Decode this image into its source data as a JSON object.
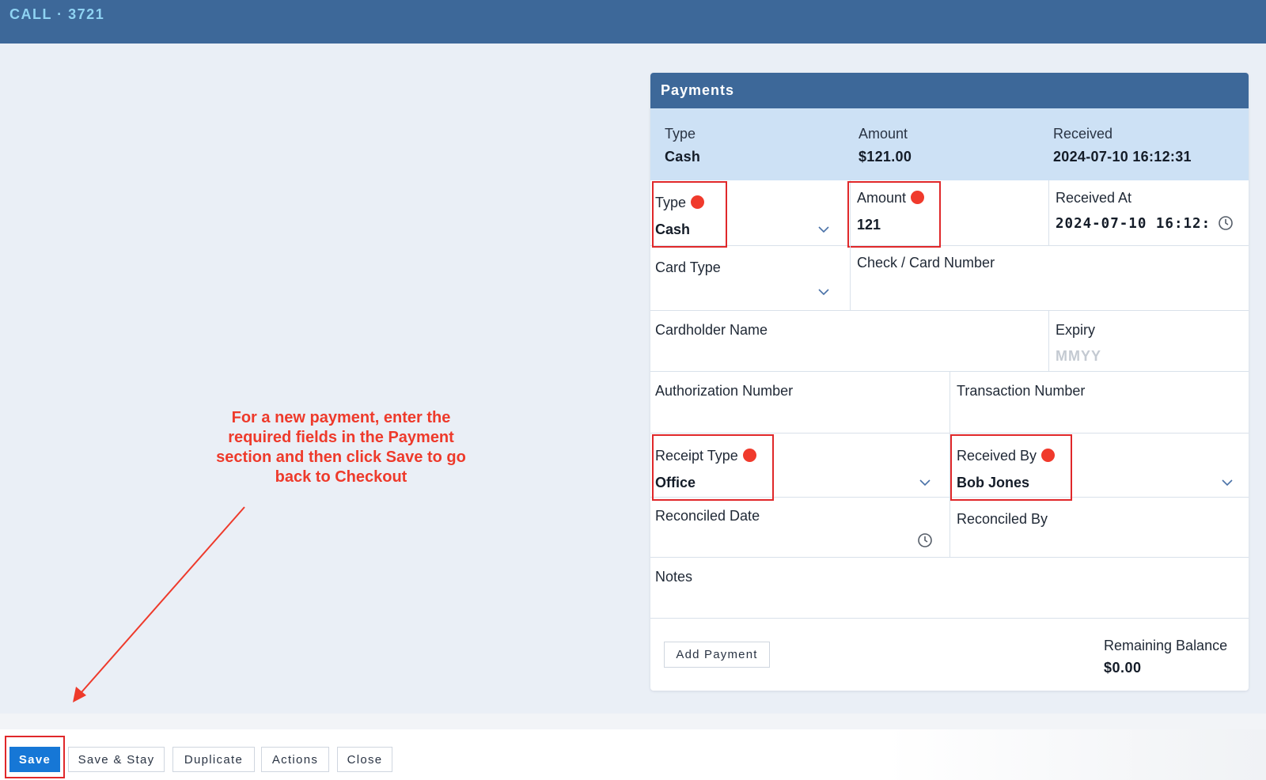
{
  "window": {
    "title": "CALL · 3721"
  },
  "payments": {
    "title": "Payments",
    "summary": {
      "type_label": "Type",
      "type_value": "Cash",
      "amount_label": "Amount",
      "amount_value": "$121.00",
      "received_label": "Received",
      "received_value": "2024-07-10 16:12:31"
    },
    "form": {
      "type_label": "Type",
      "type_value": "Cash",
      "amount_label": "Amount",
      "amount_value": "121",
      "received_at_label": "Received At",
      "received_at_value": "2024-07-10 16:12:",
      "card_type_label": "Card Type",
      "check_card_label": "Check / Card Number",
      "cardholder_label": "Cardholder Name",
      "expiry_label": "Expiry",
      "expiry_placeholder": "MMYY",
      "authorization_label": "Authorization Number",
      "transaction_label": "Transaction Number",
      "receipt_type_label": "Receipt Type",
      "receipt_type_value": "Office",
      "received_by_label": "Received By",
      "received_by_value": "Bob Jones",
      "reconciled_date_label": "Reconciled Date",
      "reconciled_by_label": "Reconciled By",
      "notes_label": "Notes"
    },
    "add_payment_label": "Add Payment",
    "remaining_balance_label": "Remaining Balance",
    "remaining_balance_value": "$0.00"
  },
  "annotation": {
    "text": "For a new payment, enter the required fields in the Payment section and then click Save to go back to Checkout",
    "color": "#ee3a2b"
  },
  "toolbar": {
    "save_label": "Save",
    "save_stay_label": "Save & Stay",
    "duplicate_label": "Duplicate",
    "actions_label": "Actions",
    "close_label": "Close"
  },
  "colors": {
    "header_blue": "#3d6899",
    "summary_bg": "#cde1f5",
    "primary_button": "#1677d6",
    "required_dot": "#f03a2c",
    "highlight_box": "#e0282a"
  },
  "icons": [
    "chevron-down-icon",
    "clock-icon",
    "required-dot-icon",
    "annotation-arrow"
  ]
}
